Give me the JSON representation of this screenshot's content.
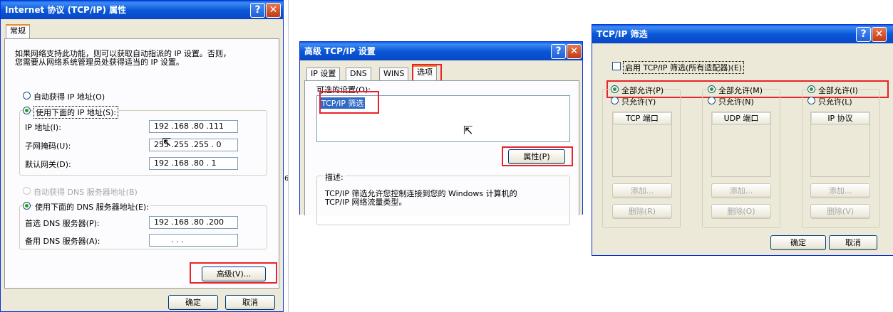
{
  "dialog1": {
    "title": "Internet 协议 (TCP/IP) 属性",
    "tab": "常规",
    "desc_line1": "如果网络支持此功能，则可以获取自动指派的 IP 设置。否则，",
    "desc_line2": "您需要从网络系统管理员处获得适当的 IP 设置。",
    "radio_auto_ip": "自动获得 IP 地址(O)",
    "radio_manual_ip": "使用下面的 IP 地址(S):",
    "ip_label": "IP 地址(I):",
    "ip_value": "192 .168 .80 .111",
    "mask_label": "子网掩码(U):",
    "mask_value": "255 .255 .255 . 0",
    "gateway_label": "默认网关(D):",
    "gateway_value": "192 .168 .80 . 1",
    "radio_auto_dns": "自动获得 DNS 服务器地址(B)",
    "radio_manual_dns": "使用下面的 DNS 服务器地址(E):",
    "dns1_label": "首选 DNS 服务器(P):",
    "dns1_value": "192 .168 .80 .200",
    "dns2_label": "备用 DNS 服务器(A):",
    "dns2_value": ".     .     .",
    "advanced_button": "高级(V)...",
    "ok_button": "确定",
    "cancel_button": "取消",
    "help_glyph": "?",
    "close_glyph": "✕"
  },
  "dialog2": {
    "title": "高级 TCP/IP 设置",
    "tabs": [
      "IP 设置",
      "DNS",
      "WINS",
      "选项"
    ],
    "optional_settings_label": "可选的设置(O):",
    "list_item": "TCP/IP 筛选",
    "properties_button": "属性(P)",
    "description_label": "描述:",
    "description_line1": "TCP/IP 筛选允许您控制连接到您的 Windows 计算机的",
    "description_line2": "TCP/IP 网络流量类型。",
    "help_glyph": "?",
    "close_glyph": "✕"
  },
  "dialog3": {
    "title": "TCP/IP 筛选",
    "enable_filtering": "启用 TCP/IP 筛选(所有适配器)(E)",
    "columns": [
      {
        "permit_all": "全部允许(P)",
        "permit_only": "只允许(Y)",
        "header": "TCP 端口",
        "add": "添加...",
        "remove": "删除(R)"
      },
      {
        "permit_all": "全部允许(M)",
        "permit_only": "只允许(N)",
        "header": "UDP 端口",
        "add": "添加...",
        "remove": "删除(O)"
      },
      {
        "permit_all": "全部允许(I)",
        "permit_only": "只允许(L)",
        "header": "IP 协议",
        "add": "添加...",
        "remove": "删除(V)"
      }
    ],
    "ok_button": "确定",
    "cancel_button": "取消",
    "help_glyph": "?",
    "close_glyph": "✕"
  },
  "stray_digit": "6",
  "colors": {
    "highlight_red": "#e8232b",
    "title_blue": "#0a58d8",
    "selection_blue": "#316ac5"
  }
}
